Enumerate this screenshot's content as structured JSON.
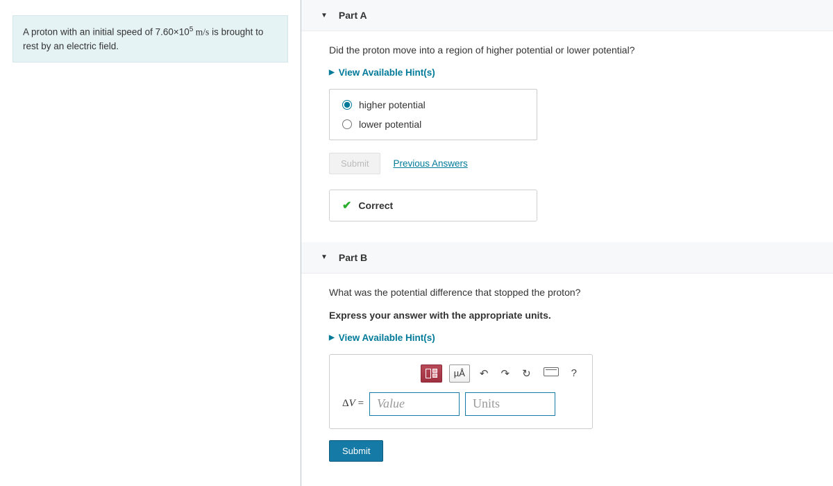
{
  "problem": {
    "text_pre": "A proton with an initial speed of 7.60×10",
    "exp": "5",
    "units": " m/s",
    "text_post": " is brought to rest by an electric field."
  },
  "partA": {
    "title": "Part A",
    "question": "Did the proton move into a region of higher potential or lower potential?",
    "hints_label": "View Available Hint(s)",
    "options": [
      {
        "label": "higher potential",
        "selected": true
      },
      {
        "label": "lower potential",
        "selected": false
      }
    ],
    "submit_label": "Submit",
    "previous_label": "Previous Answers",
    "feedback": "Correct"
  },
  "partB": {
    "title": "Part B",
    "question": "What was the potential difference that stopped the proton?",
    "instruction": "Express your answer with the appropriate units.",
    "hints_label": "View Available Hint(s)",
    "toolbar": {
      "units_btn": "µÅ",
      "help": "?"
    },
    "answer": {
      "lhs": "ΔV =",
      "value_placeholder": "Value",
      "units_placeholder": "Units"
    },
    "submit_label": "Submit"
  }
}
